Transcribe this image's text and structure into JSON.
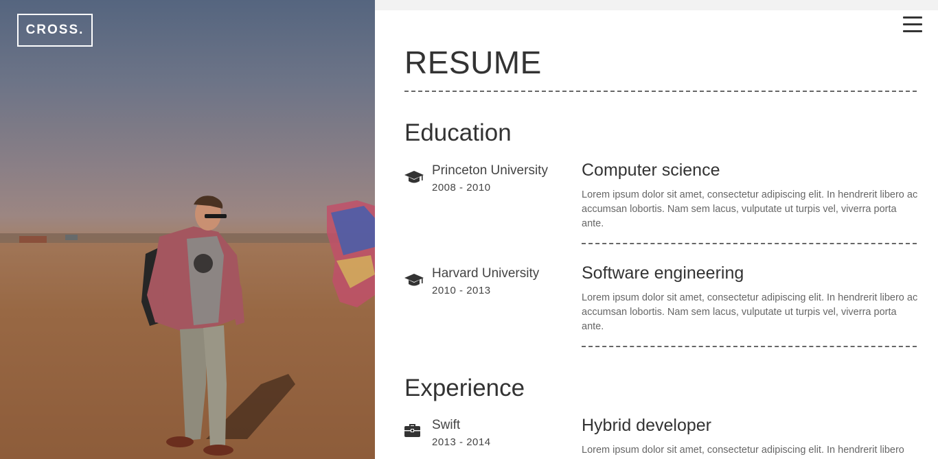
{
  "brand": {
    "logo_text": "CROSS."
  },
  "header": {
    "menu_icon": "hamburger-menu-icon"
  },
  "page": {
    "title": "RESUME"
  },
  "education": {
    "heading": "Education",
    "entries": [
      {
        "icon": "graduation-cap-icon",
        "org": "Princeton University",
        "years": "2008 - 2010",
        "role": "Computer science",
        "description": "Lorem ipsum dolor sit amet, consectetur adipiscing elit. In hendrerit libero ac accumsan lobortis. Nam sem lacus, vulputate ut turpis vel, viverra porta ante."
      },
      {
        "icon": "graduation-cap-icon",
        "org": "Harvard University",
        "years": "2010 - 2013",
        "role": "Software engineering",
        "description": "Lorem ipsum dolor sit amet, consectetur adipiscing elit. In hendrerit libero ac accumsan lobortis. Nam sem lacus, vulputate ut turpis vel, viverra porta ante."
      }
    ]
  },
  "experience": {
    "heading": "Experience",
    "entries": [
      {
        "icon": "briefcase-icon",
        "org": "Swift",
        "years": "2013 - 2014",
        "role": "Hybrid developer",
        "description": "Lorem ipsum dolor sit amet, consectetur adipiscing elit. In hendrerit libero"
      }
    ]
  },
  "colors": {
    "text_dark": "#333333",
    "text_muted": "#666666",
    "top_strip": "#f2f2f2",
    "logo_border": "#ffffff"
  }
}
